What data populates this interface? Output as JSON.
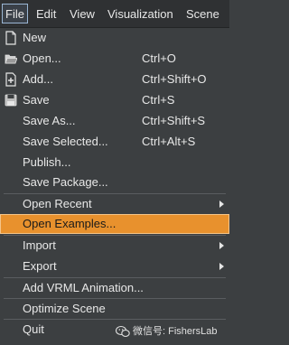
{
  "menubar": {
    "items": [
      "File",
      "Edit",
      "View",
      "Visualization",
      "Scene"
    ]
  },
  "file_menu": {
    "items": [
      {
        "label": "New",
        "shortcut": "",
        "icon": "new-file-icon"
      },
      {
        "label": "Open...",
        "shortcut": "Ctrl+O",
        "icon": "open-folder-icon"
      },
      {
        "label": "Add...",
        "shortcut": "Ctrl+Shift+O",
        "icon": "add-file-icon"
      },
      {
        "label": "Save",
        "shortcut": "Ctrl+S",
        "icon": "save-icon"
      },
      {
        "label": "Save As...",
        "shortcut": "Ctrl+Shift+S"
      },
      {
        "label": "Save Selected...",
        "shortcut": "Ctrl+Alt+S"
      },
      {
        "label": "Publish...",
        "shortcut": ""
      },
      {
        "label": "Save Package...",
        "shortcut": ""
      },
      {
        "label": "Open Recent",
        "submenu": true
      },
      {
        "label": "Open Examples...",
        "highlighted": true
      },
      {
        "label": "Import",
        "submenu": true
      },
      {
        "label": "Export",
        "submenu": true
      },
      {
        "label": "Add VRML Animation..."
      },
      {
        "label": "Optimize Scene"
      },
      {
        "label": "Quit"
      }
    ]
  },
  "watermark": {
    "text": "微信号: FishersLab"
  },
  "colors": {
    "highlight": "#e8912d",
    "background": "#3c3f41",
    "menubar": "#2f3133"
  }
}
